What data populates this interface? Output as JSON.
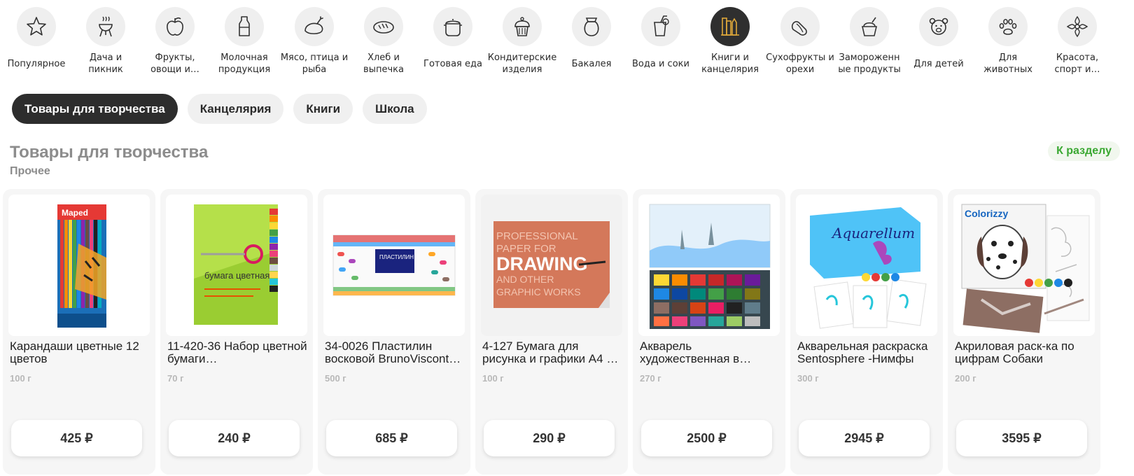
{
  "categories": [
    {
      "label": "Популярное",
      "icon": "star-icon"
    },
    {
      "label": "Дача и\nпикник",
      "icon": "grill-icon"
    },
    {
      "label": "Фрукты,\nовощи и…",
      "icon": "apple-icon"
    },
    {
      "label": "Молочная\nпродукция",
      "icon": "milk-bottle-icon"
    },
    {
      "label": "Мясо, птица и\nрыба",
      "icon": "chicken-icon"
    },
    {
      "label": "Хлеб и\nвыпечка",
      "icon": "bread-icon"
    },
    {
      "label": "Готовая еда",
      "icon": "pot-icon"
    },
    {
      "label": "Кондитерские\nизделия",
      "icon": "cupcake-icon"
    },
    {
      "label": "Бакалея",
      "icon": "sack-icon"
    },
    {
      "label": "Вода и соки",
      "icon": "juice-icon"
    },
    {
      "label": "Книги и\nканцелярия",
      "icon": "books-pencil-icon",
      "active": true
    },
    {
      "label": "Сухофрукты и\nорехи",
      "icon": "nuts-icon"
    },
    {
      "label": "Замороженн\nые продукты",
      "icon": "ice-cream-icon"
    },
    {
      "label": "Для детей",
      "icon": "teddy-bear-icon"
    },
    {
      "label": "Для\nживотных",
      "icon": "paw-icon"
    },
    {
      "label": "Красота,\nспорт и…",
      "icon": "lotus-icon"
    }
  ],
  "tabs": [
    {
      "label": "Товары для творчества",
      "active": true
    },
    {
      "label": "Канцелярия"
    },
    {
      "label": "Книги"
    },
    {
      "label": "Школа"
    }
  ],
  "section": {
    "title": "Товары для творчества",
    "subtitle": "Прочее",
    "link": "К разделу"
  },
  "products": [
    {
      "title": "Карандаши цветные 12 цветов",
      "weight": "100 г",
      "price": "425 ₽",
      "image": "colored-pencils-box"
    },
    {
      "title": "11-420-36 Набор цветной бумаги…",
      "weight": "70 г",
      "price": "240 ₽",
      "image": "color-paper-set"
    },
    {
      "title": "34-0026 Пластилин восковой BrunoViscont…",
      "weight": "500 г",
      "price": "685 ₽",
      "image": "plasticine-box"
    },
    {
      "title": "4-127 Бумага для рисунка и графики А4 …",
      "weight": "100 г",
      "price": "290 ₽",
      "image": "drawing-paper-pad"
    },
    {
      "title": "Акварель художественная в…",
      "weight": "270 г",
      "price": "2500 ₽",
      "image": "watercolor-set"
    },
    {
      "title": "Акварельная раскраска Sentosphere -Нимфы",
      "weight": "300 г",
      "price": "2945 ₽",
      "image": "aquarellum-kit"
    },
    {
      "title": "Акриловая раск-ка по цифрам Собаки",
      "weight": "200 г",
      "price": "3595 ₽",
      "image": "colorizzy-kit"
    }
  ],
  "product_image_text": {
    "pencils_brand": "Maped",
    "paper_label": "бумага цветная",
    "plasticine_label": "ПЛАСТИЛИН",
    "drawing_pad": [
      "PROFESSIONAL",
      "PAPER FOR",
      "DRAWING",
      "AND OTHER",
      "GRAPHIC WORKS"
    ],
    "aquarellum_label": "Aquarellum",
    "colorizzy_label": "Colorizzy"
  },
  "colors": {
    "accent_green": "#3aa832",
    "active_dark": "#2d2d2d",
    "active_icon": "#e0a93a"
  }
}
